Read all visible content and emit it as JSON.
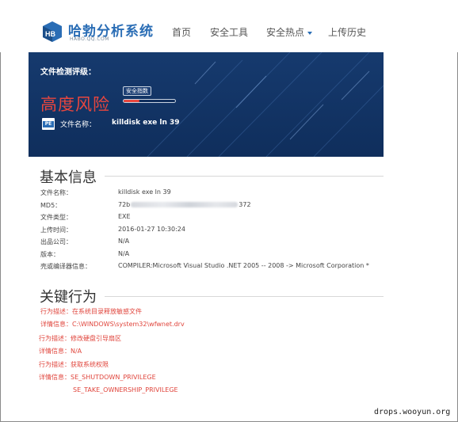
{
  "header": {
    "brand_name": "哈勃分析系统",
    "brand_sub": "HABO.QQ.COM",
    "nav": [
      {
        "label": "首页"
      },
      {
        "label": "安全工具"
      },
      {
        "label": "安全热点"
      },
      {
        "label": "上传历史"
      }
    ],
    "accent_color": "#2a6db5"
  },
  "banner": {
    "label": "文件检测评级：",
    "risk_level": "高度风险",
    "safety_tag": "安全指数",
    "safety_index_fraction": 0.3,
    "file_icon": "PE",
    "file_name_label": "文件名称：",
    "file_name_value": "killdisk exe ln 39",
    "risk_color": "#e8463e"
  },
  "basic_info": {
    "title": "基本信息",
    "rows": [
      {
        "label": "文件名称：",
        "value": "killdisk exe ln 39"
      },
      {
        "label": "MD5：",
        "value_prefix": "72b",
        "value_suffix": "372"
      },
      {
        "label": "文件类型：",
        "value": "EXE"
      },
      {
        "label": "上传时间：",
        "value": "2016-01-27 10:30:24"
      },
      {
        "label": "出品公司：",
        "value": "N/A"
      },
      {
        "label": "版本：",
        "value": "N/A"
      },
      {
        "label": "壳或编译器信息：",
        "value": "COMPILER:Microsoft Visual Studio .NET 2005 -- 2008 -> Microsoft Corporation *"
      }
    ]
  },
  "key_behavior": {
    "title": "关键行为",
    "items": [
      {
        "text": "行为描述：在系统目录释放敏感文件"
      },
      {
        "text": "详情信息：C:\\WINDOWS\\system32\\wfwnet.drv"
      },
      {
        "text": "行为描述：修改硬盘引导扇区"
      },
      {
        "text": "详情信息：N/A"
      },
      {
        "text": "行为描述：获取系统权限"
      },
      {
        "text": "详情信息：SE_SHUTDOWN_PRIVILEGE"
      },
      {
        "text": "SE_TAKE_OWNERSHIP_PRIVILEGE"
      }
    ],
    "color": "#e0453c"
  },
  "watermark": "drops.wooyun.org"
}
